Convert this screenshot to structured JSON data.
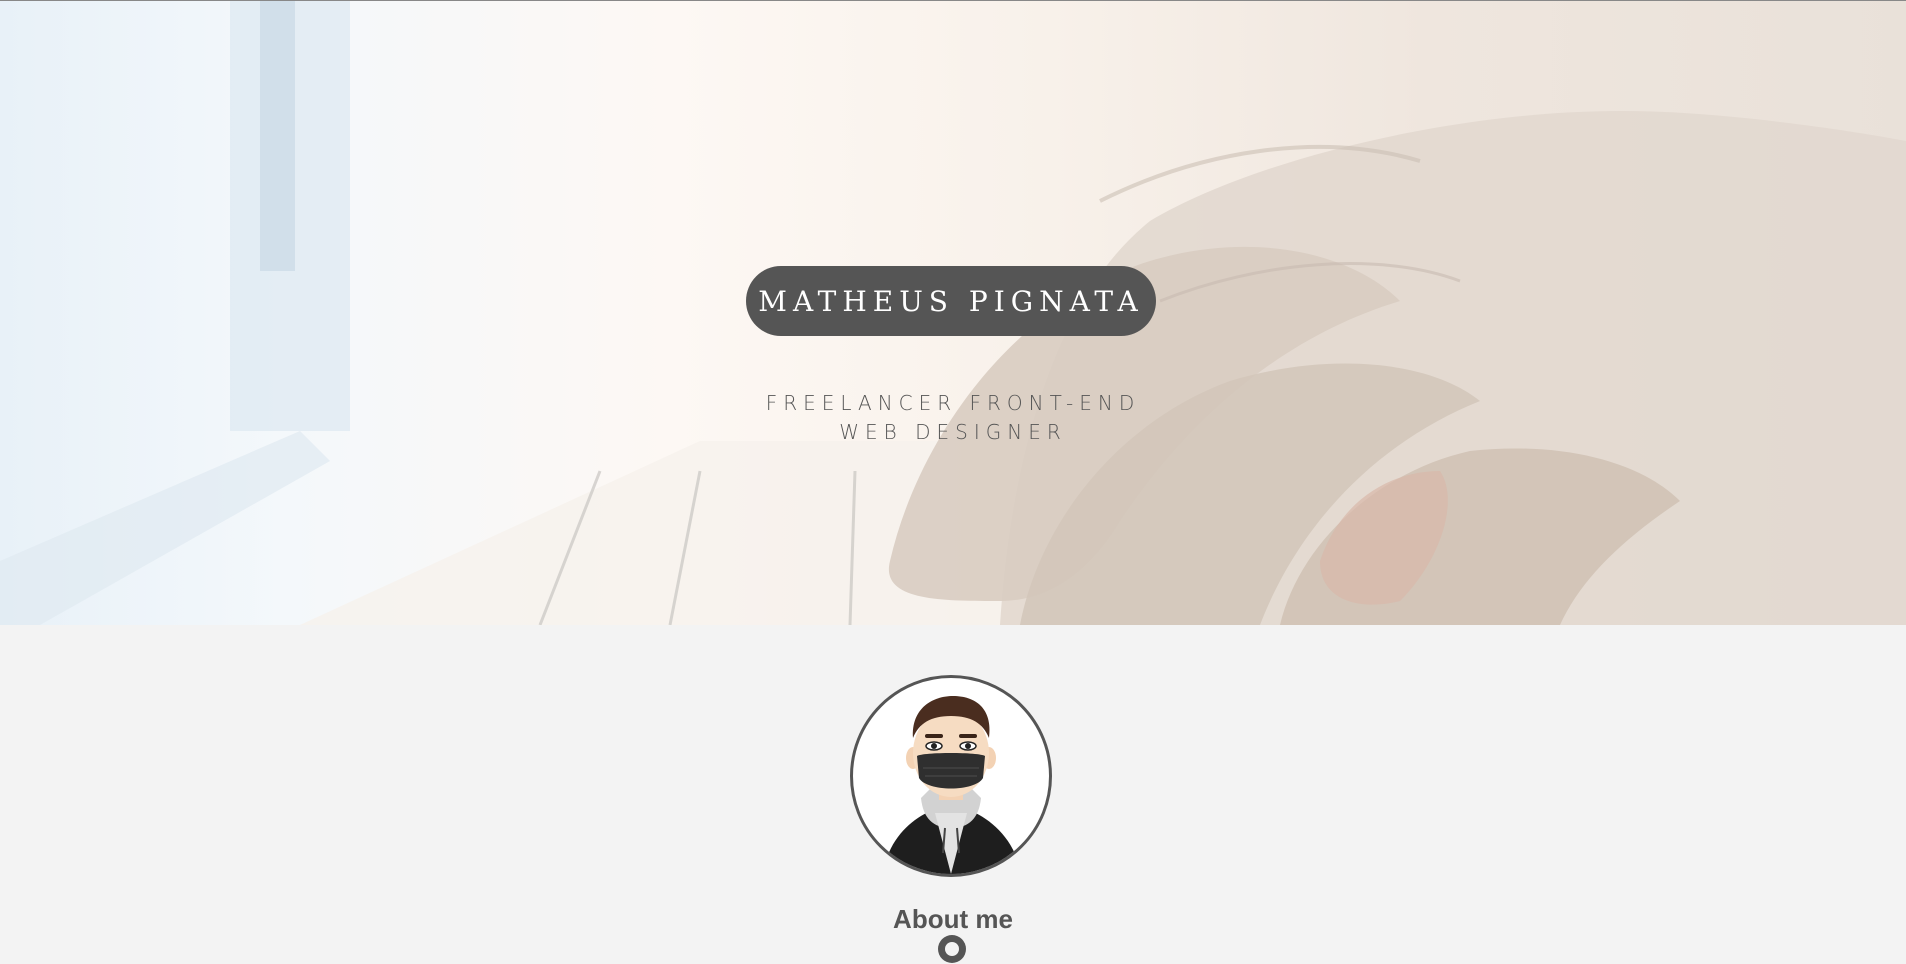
{
  "hero": {
    "name": "MATHEUS PIGNATA",
    "subtitle_line1": "FREELANCER FRONT-END",
    "subtitle_line2": "WEB DESIGNER",
    "background_image": "hand-typing-on-laptop-keyboard"
  },
  "about": {
    "avatar_image": "cartoon-portrait-with-black-mask",
    "title": "About me",
    "indicator_icon": "ring-icon"
  },
  "colors": {
    "pill": "#555555",
    "page_background": "#f3f3f3",
    "text": "#555555"
  }
}
